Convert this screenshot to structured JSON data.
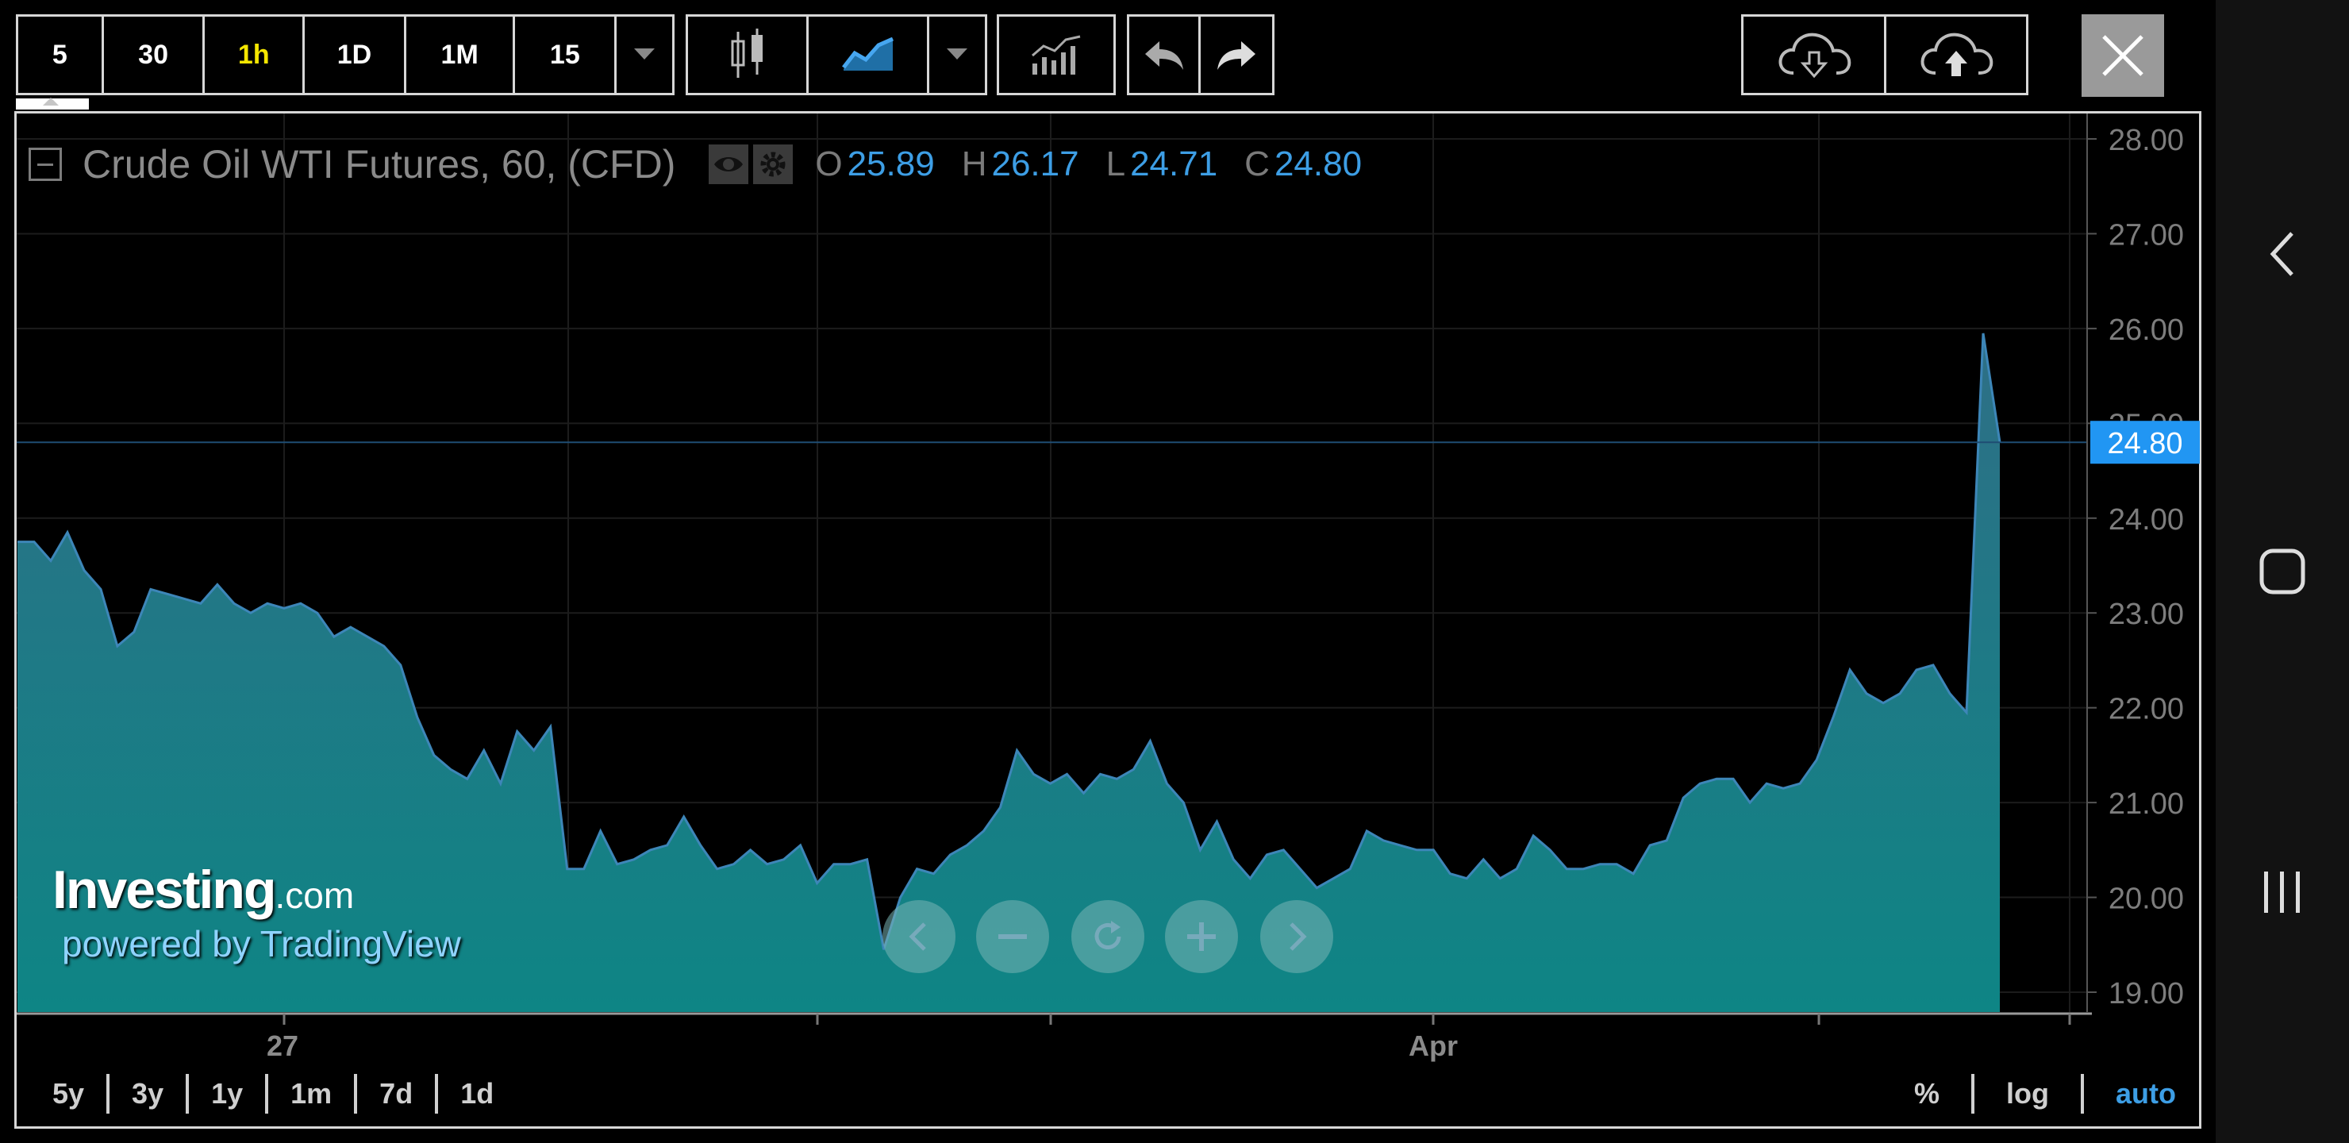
{
  "toolbar": {
    "intervals": [
      "5",
      "30",
      "1h",
      "1D",
      "1M",
      "15"
    ],
    "active_interval": "1h"
  },
  "legend": {
    "title": "Crude Oil WTI Futures, 60, (CFD)",
    "open_label": "O",
    "open": "25.89",
    "high_label": "H",
    "high": "26.17",
    "low_label": "L",
    "low": "24.71",
    "close_label": "C",
    "close": "24.80"
  },
  "watermark": {
    "brand": "Investing",
    "brand_suffix": ".com",
    "powered": "powered by TradingView"
  },
  "ranges": [
    "5y",
    "3y",
    "1y",
    "1m",
    "7d",
    "1d"
  ],
  "bottom_options": [
    "%",
    "log",
    "auto"
  ],
  "colors": {
    "area_fill_top": "#2e6f86",
    "area_fill_bottom": "#0e8585",
    "line": "#3d86b8",
    "price_label_bg": "#2196f3",
    "active_interval": "#f5e600",
    "ohlc_value": "#3d9ee5"
  },
  "chart_data": {
    "type": "area",
    "title": "Crude Oil WTI Futures, 60, (CFD)",
    "xlabel": "",
    "ylabel": "",
    "ylim": [
      18.8,
      28.0
    ],
    "y_ticks": [
      "28.00",
      "27.00",
      "26.00",
      "25.00",
      "24.00",
      "23.00",
      "22.00",
      "21.00",
      "20.00",
      "19.00"
    ],
    "x_tick_labels": [
      "27",
      "Apr"
    ],
    "last_price_label": "24.80",
    "last_price": 24.8,
    "values": [
      23.75,
      23.75,
      23.55,
      23.85,
      23.45,
      23.25,
      22.65,
      22.8,
      23.25,
      23.2,
      23.15,
      23.1,
      23.3,
      23.1,
      23.0,
      23.1,
      23.05,
      23.1,
      23.0,
      22.75,
      22.85,
      22.75,
      22.65,
      22.45,
      21.9,
      21.5,
      21.35,
      21.25,
      21.55,
      21.2,
      21.75,
      21.55,
      21.8,
      20.3,
      20.3,
      20.7,
      20.35,
      20.4,
      20.5,
      20.55,
      20.85,
      20.55,
      20.3,
      20.35,
      20.5,
      20.35,
      20.4,
      20.55,
      20.15,
      20.35,
      20.35,
      20.4,
      19.45,
      20.0,
      20.3,
      20.25,
      20.45,
      20.55,
      20.7,
      20.95,
      21.55,
      21.3,
      21.2,
      21.3,
      21.1,
      21.3,
      21.25,
      21.35,
      21.65,
      21.2,
      21.0,
      20.5,
      20.8,
      20.4,
      20.2,
      20.45,
      20.5,
      20.3,
      20.1,
      20.2,
      20.3,
      20.7,
      20.6,
      20.55,
      20.5,
      20.5,
      20.25,
      20.2,
      20.4,
      20.2,
      20.3,
      20.65,
      20.5,
      20.3,
      20.3,
      20.35,
      20.35,
      20.25,
      20.55,
      20.6,
      21.05,
      21.2,
      21.25,
      21.25,
      21.0,
      21.2,
      21.15,
      21.2,
      21.45,
      21.9,
      22.4,
      22.15,
      22.05,
      22.15,
      22.4,
      22.45,
      22.15,
      21.95,
      25.95,
      24.8
    ]
  }
}
